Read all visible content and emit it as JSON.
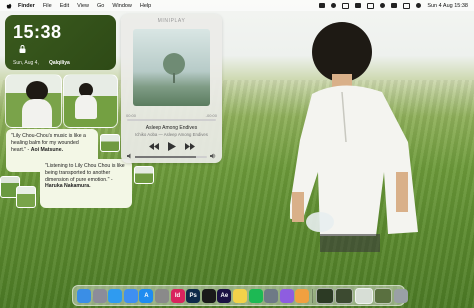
{
  "menubar": {
    "app_name": "Finder",
    "menus": [
      "File",
      "Edit",
      "View",
      "Go",
      "Window",
      "Help"
    ],
    "datetime": "Sun 4 Aug 15:38"
  },
  "clock_widget": {
    "time": "15:38",
    "date": "Sun, Aug 4,",
    "location": "Qalqiliya"
  },
  "miniplayer": {
    "title": "MINIPLAY",
    "elapsed": "00:00",
    "remaining": "-00:00",
    "track": "Asleep Among Endives",
    "artist_album": "Ichiko Aoba — Asleep Among Endives",
    "progress_fraction": 0.0,
    "volume_fraction": 0.85
  },
  "quotes": [
    {
      "text": "\"Lily Chou-Chou's music is like a healing balm for my wounded heart.\" -",
      "author": "Aoi Matsune."
    },
    {
      "text": "\"Listening to Lily Chou Chou is like being transported to another dimension of pure emotion.\" -",
      "author": "Haruka Nakamura."
    }
  ],
  "dock": {
    "apps": [
      {
        "name": "finder",
        "label": "",
        "color": "#3a8ee6"
      },
      {
        "name": "launchpad",
        "label": "",
        "color": "#8c8c9a"
      },
      {
        "name": "safari",
        "label": "",
        "color": "#2f9bf0"
      },
      {
        "name": "mail",
        "label": "",
        "color": "#3f8ff2"
      },
      {
        "name": "app-store",
        "label": "A",
        "color": "#1f8cf0"
      },
      {
        "name": "system-settings",
        "label": "",
        "color": "#8a8a8a"
      },
      {
        "name": "indesign",
        "label": "Id",
        "color": "#d9245e"
      },
      {
        "name": "photoshop",
        "label": "Ps",
        "color": "#0e2a4a"
      },
      {
        "name": "app-black",
        "label": "",
        "color": "#1a1a1a"
      },
      {
        "name": "after-effects",
        "label": "Ae",
        "color": "#1b1143"
      },
      {
        "name": "notes",
        "label": "",
        "color": "#f2d24a"
      },
      {
        "name": "spotify",
        "label": "",
        "color": "#1db954"
      },
      {
        "name": "app-gray",
        "label": "",
        "color": "#6e7a86"
      },
      {
        "name": "infuse",
        "label": "",
        "color": "#8e5de0"
      },
      {
        "name": "photos",
        "label": "",
        "color": "#f0a040"
      }
    ],
    "recent": [
      {
        "name": "window-thumb-1",
        "color": "#2c3a24"
      },
      {
        "name": "window-thumb-2",
        "color": "#3c4a30"
      },
      {
        "name": "window-thumb-3",
        "color": "#d7ded6"
      },
      {
        "name": "window-thumb-4",
        "color": "#5a7040"
      }
    ],
    "trash_color": "#9aa0a6"
  }
}
